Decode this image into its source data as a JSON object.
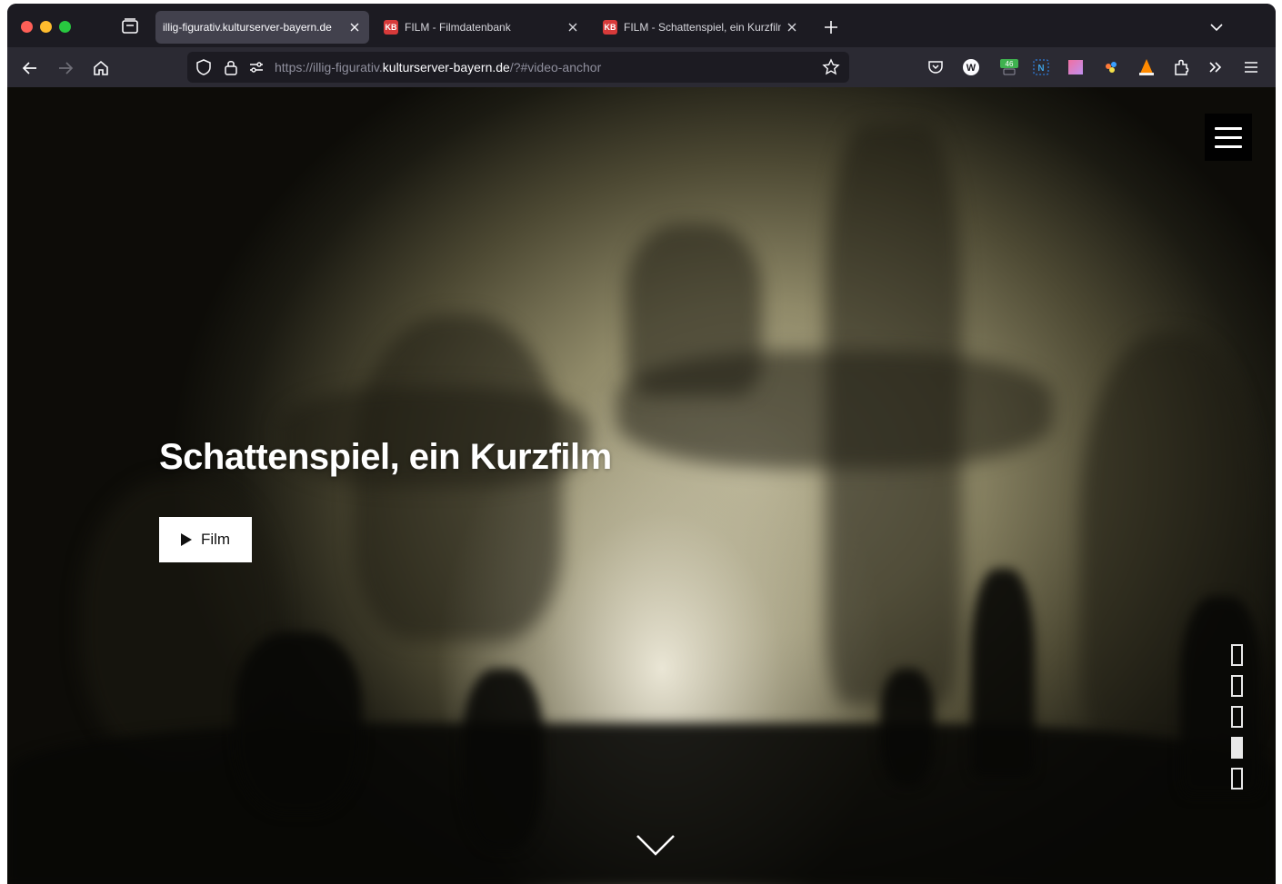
{
  "browser": {
    "tabs": [
      {
        "title": "illig-figurativ.kulturserver-bayern.de",
        "active": true,
        "favicon": ""
      },
      {
        "title": "FILM - Filmdatenbank",
        "active": false,
        "favicon": "KB"
      },
      {
        "title": "FILM - Schattenspiel, ein Kurzfilm",
        "active": false,
        "favicon": "KB"
      }
    ],
    "url": {
      "prefix": "https://illig-figurativ.",
      "host": "kulturserver-bayern.de",
      "suffix": "/?#video-anchor"
    },
    "extensions": [
      {
        "name": "pocket-icon"
      },
      {
        "name": "w-extension-icon",
        "glyph": "W"
      },
      {
        "name": "counter-extension-icon",
        "badge": "46"
      },
      {
        "name": "n-extension-icon",
        "glyph": "N"
      },
      {
        "name": "color-extension-icon"
      },
      {
        "name": "dots-extension-icon"
      },
      {
        "name": "vlc-extension-icon"
      },
      {
        "name": "puzzle-icon"
      },
      {
        "name": "overflow-icon"
      },
      {
        "name": "hamburger-menu-icon"
      }
    ]
  },
  "hero": {
    "title": "Schattenspiel, ein Kurzfilm",
    "film_button": "Film"
  },
  "section_nav": {
    "count": 5,
    "active_index": 3
  },
  "colors": {
    "accent_white": "#ffffff",
    "menu_bg": "#000000",
    "browser_chrome": "#1c1b22"
  }
}
